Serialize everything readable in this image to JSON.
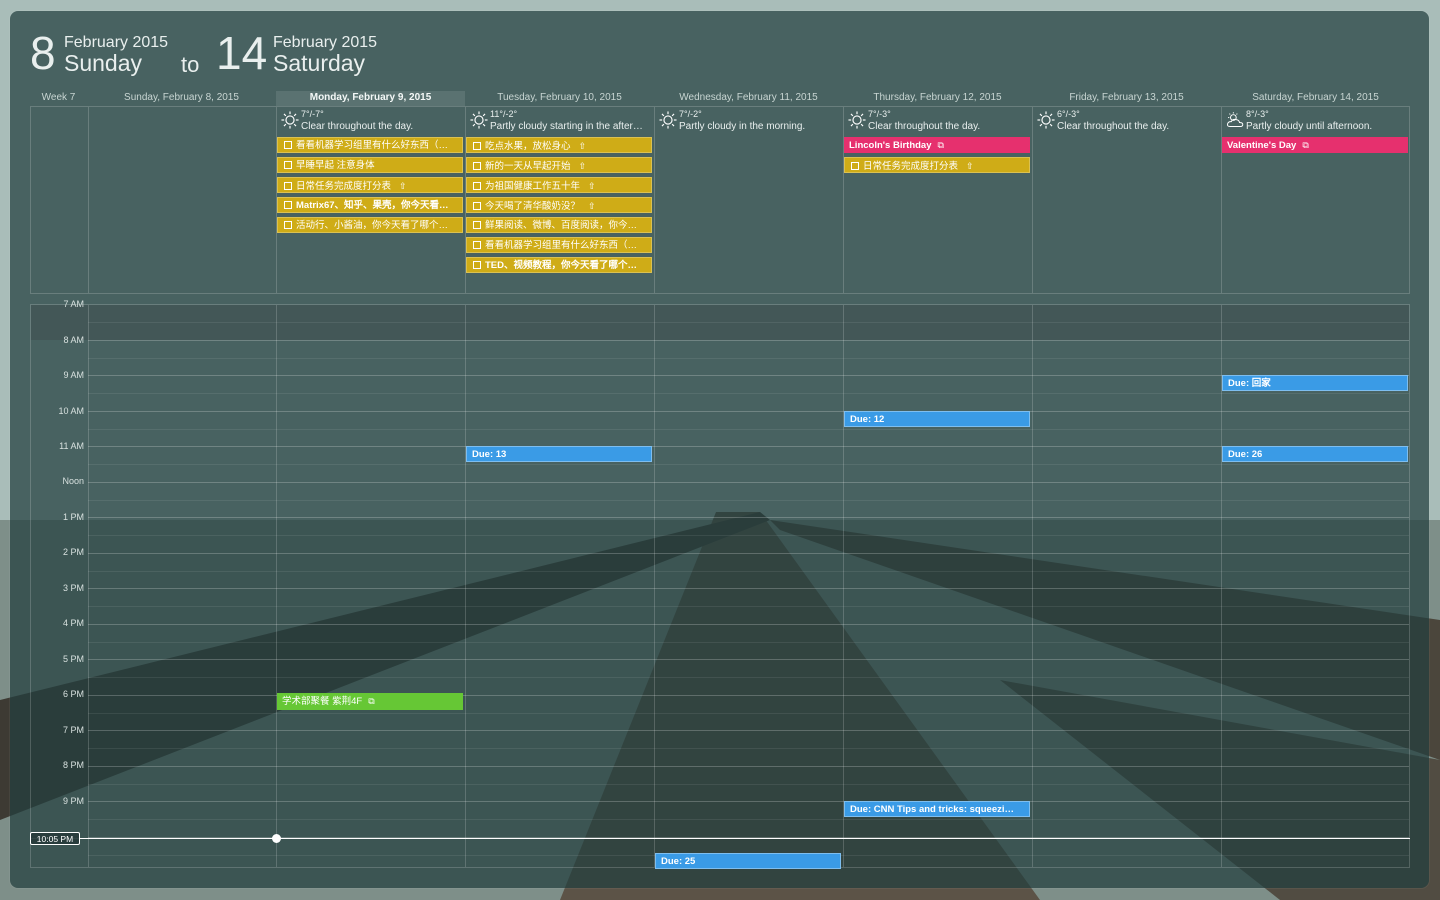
{
  "header": {
    "start": {
      "day": "8",
      "month": "February 2015",
      "weekday": "Sunday"
    },
    "to": "to",
    "end": {
      "day": "14",
      "month": "February 2015",
      "weekday": "Saturday"
    }
  },
  "week_label": "Week 7",
  "days": [
    {
      "label": "Sunday, February 8, 2015"
    },
    {
      "label": "Monday, February 9, 2015",
      "selected": true
    },
    {
      "label": "Tuesday, February 10, 2015"
    },
    {
      "label": "Wednesday, February 11, 2015"
    },
    {
      "label": "Thursday, February 12, 2015"
    },
    {
      "label": "Friday, February 13, 2015"
    },
    {
      "label": "Saturday, February 14, 2015"
    }
  ],
  "weather": [
    {
      "temp": "7°/-7°",
      "desc": "Clear throughout the day.",
      "icon": "sun-icon"
    },
    {
      "temp": "11°/-2°",
      "desc": "Partly cloudy starting in the after…",
      "icon": "sun-icon"
    },
    {
      "temp": "7°/-2°",
      "desc": "Partly cloudy in the morning.",
      "icon": "sun-icon"
    },
    {
      "temp": "7°/-3°",
      "desc": "Clear throughout the day.",
      "icon": "sun-icon"
    },
    {
      "temp": "6°/-3°",
      "desc": "Clear throughout the day.",
      "icon": "sun-icon"
    },
    {
      "temp": "8°/-3°",
      "desc": "Partly cloudy until afternoon.",
      "icon": "partly-cloudy-icon"
    }
  ],
  "tasks_monday": [
    {
      "text": "看看机器学习组里有什么好东西（…",
      "bold": false,
      "repeat": false
    },
    {
      "text": "早睡早起 注意身体",
      "bold": false,
      "repeat": false
    },
    {
      "text": "日常任务完成度打分表",
      "bold": false,
      "repeat": true
    },
    {
      "text": "Matrix67、知乎、果壳，你今天看…",
      "bold": true,
      "repeat": false
    },
    {
      "text": "活动行、小酱油，你今天看了哪个…",
      "bold": false,
      "repeat": false
    }
  ],
  "tasks_tuesday": [
    {
      "text": "吃点水果，放松身心",
      "bold": false,
      "repeat": true
    },
    {
      "text": "新的一天从早起开始",
      "bold": false,
      "repeat": true
    },
    {
      "text": "为祖国健康工作五十年",
      "bold": false,
      "repeat": true
    },
    {
      "text": "今天喝了清华酸奶没？",
      "bold": false,
      "repeat": true
    },
    {
      "text": "鲜果阅读、微博、百度阅读，你今…",
      "bold": false,
      "repeat": false
    },
    {
      "text": "看看机器学习组里有什么好东西（…",
      "bold": false,
      "repeat": false
    },
    {
      "text": "TED、视频教程，你今天看了哪个…",
      "bold": true,
      "repeat": false
    }
  ],
  "thursday_allday": {
    "birthday": "Lincoln's Birthday",
    "task": "日常任务完成度打分表"
  },
  "saturday_allday": {
    "holiday": "Valentine's Day"
  },
  "time_labels": [
    "7 AM",
    "8 AM",
    "9 AM",
    "10 AM",
    "11 AM",
    "Noon",
    "1 PM",
    "2 PM",
    "3 PM",
    "4 PM",
    "5 PM",
    "6 PM",
    "7 PM",
    "8 PM",
    "9 PM"
  ],
  "events": {
    "tue_due_13": "Due: 13",
    "thu_due_12": "Due: 12",
    "thu_due_cnn": "Due: CNN Tips and tricks: squeezi…",
    "wed_due_25": "Due: 25",
    "sat_due_home": "Due: 回家",
    "sat_due_26": "Due: 26",
    "mon_green": "学术部聚餐 紫荆4F"
  },
  "now_label": "10:05 PM",
  "colors": {
    "task": "#cfac17",
    "pink": "#e6306e",
    "due": "#3a9be6",
    "green": "#66c735"
  }
}
